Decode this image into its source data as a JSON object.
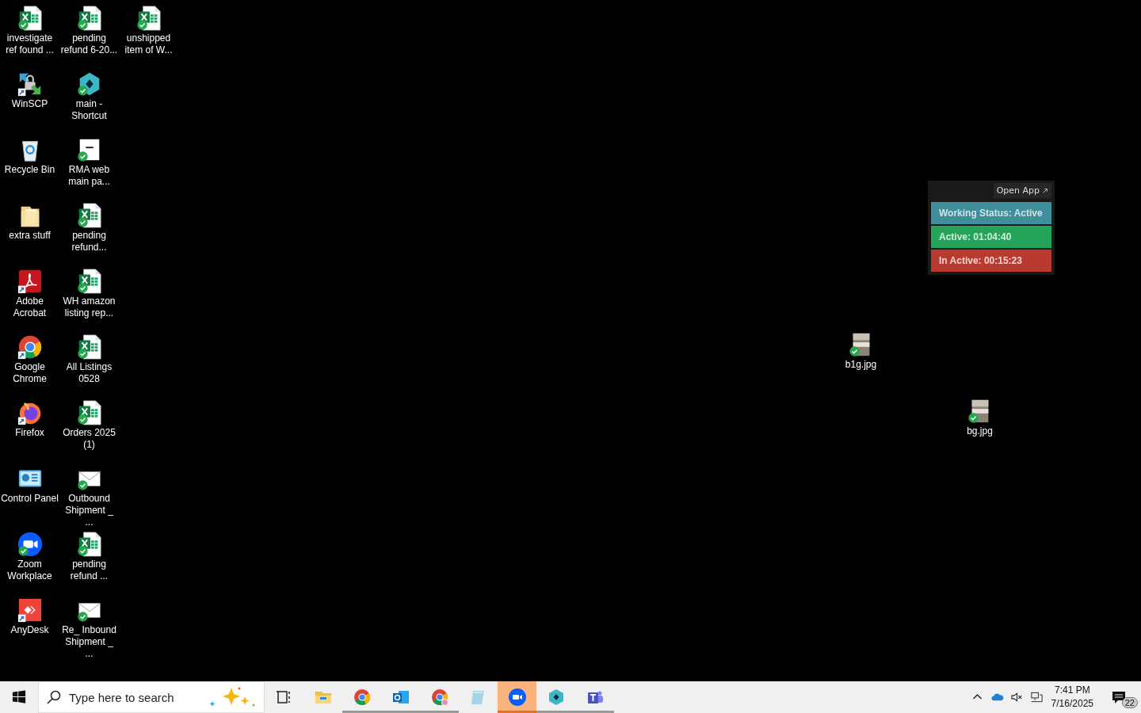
{
  "desktop": {
    "icons": [
      {
        "label": "investigate ref found ...",
        "kind": "excel",
        "synced": true,
        "shortcut": false
      },
      {
        "label": "WinSCP",
        "kind": "winscp",
        "synced": false,
        "shortcut": true
      },
      {
        "label": "Recycle Bin",
        "kind": "recycle",
        "synced": false,
        "shortcut": false
      },
      {
        "label": "extra stuff",
        "kind": "folder",
        "synced": false,
        "shortcut": false
      },
      {
        "label": "Adobe Acrobat",
        "kind": "pdf",
        "synced": false,
        "shortcut": true
      },
      {
        "label": "Google Chrome",
        "kind": "chrome",
        "synced": false,
        "shortcut": true
      },
      {
        "label": "Firefox",
        "kind": "firefox",
        "synced": false,
        "shortcut": true
      },
      {
        "label": "Control Panel",
        "kind": "control",
        "synced": false,
        "shortcut": false
      },
      {
        "label": "Zoom Workplace",
        "kind": "zoom",
        "synced": true,
        "shortcut": false
      },
      {
        "label": "AnyDesk",
        "kind": "anydesk",
        "synced": false,
        "shortcut": true
      },
      {
        "label": "pending refund 6-20...",
        "kind": "excel",
        "synced": true,
        "shortcut": false
      },
      {
        "label": "main - Shortcut",
        "kind": "hex",
        "synced": true,
        "shortcut": false
      },
      {
        "label": "RMA web main pa...",
        "kind": "webpage",
        "synced": true,
        "shortcut": false
      },
      {
        "label": "pending refund...",
        "kind": "excel",
        "synced": true,
        "shortcut": false
      },
      {
        "label": "WH amazon listing rep...",
        "kind": "excel",
        "synced": true,
        "shortcut": false
      },
      {
        "label": "All Listings 0528",
        "kind": "excel",
        "synced": true,
        "shortcut": false
      },
      {
        "label": "Orders 2025 (1)",
        "kind": "excel",
        "synced": true,
        "shortcut": false
      },
      {
        "label": "Outbound Shipment _ ...",
        "kind": "mail",
        "synced": true,
        "shortcut": false
      },
      {
        "label": "pending refund ...",
        "kind": "excel",
        "synced": true,
        "shortcut": false
      },
      {
        "label": "Re_ Inbound Shipment _ ...",
        "kind": "mail",
        "synced": true,
        "shortcut": false
      },
      {
        "label": "unshipped item of W...",
        "kind": "excel",
        "synced": true,
        "shortcut": false
      }
    ],
    "loose_icons": [
      {
        "label": "b1g.jpg",
        "kind": "image",
        "synced": true,
        "shortcut": false
      },
      {
        "label": "bg.jpg",
        "kind": "image",
        "synced": true,
        "shortcut": false
      }
    ]
  },
  "tracker_widget": {
    "open_app": "Open App",
    "rows": [
      {
        "kind": "status",
        "text": "Working Status: Active"
      },
      {
        "kind": "active",
        "text": "Active: 01:04:40"
      },
      {
        "kind": "inactive",
        "text": "In Active: 00:15:23"
      }
    ]
  },
  "taskbar": {
    "search": {
      "placeholder": "Type here to search"
    },
    "apps": [
      {
        "kind": "taskview",
        "running": false,
        "selected": false
      },
      {
        "kind": "explorer",
        "running": false,
        "selected": false
      },
      {
        "kind": "chrome",
        "running": true,
        "selected": false
      },
      {
        "kind": "outlook",
        "running": true,
        "selected": false
      },
      {
        "kind": "chrome-profile",
        "running": true,
        "selected": false
      },
      {
        "kind": "notepad",
        "running": false,
        "selected": false
      },
      {
        "kind": "zoom",
        "running": true,
        "selected": true
      },
      {
        "kind": "hex",
        "running": true,
        "selected": false
      },
      {
        "kind": "teams",
        "running": true,
        "selected": false
      }
    ],
    "clock": {
      "time": "7:41 PM",
      "date": "7/16/2025"
    },
    "notifications": {
      "count": "22"
    }
  }
}
